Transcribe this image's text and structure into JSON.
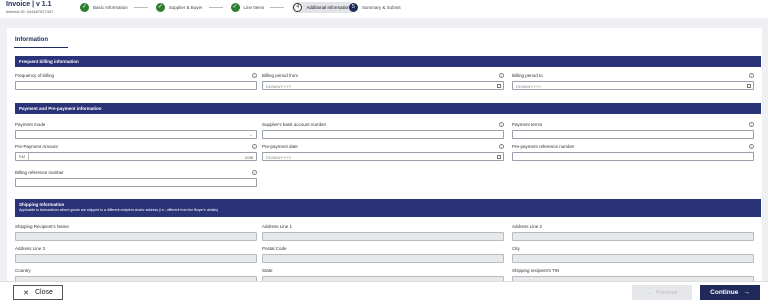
{
  "header": {
    "title": "Invoice | v 1.1",
    "internal_id": "Internal ID: 344467027447"
  },
  "steps": [
    {
      "label": "Basic Information",
      "status": "done"
    },
    {
      "label": "Supplier & Buyer",
      "status": "done"
    },
    {
      "label": "Line Items",
      "status": "done"
    },
    {
      "label": "Additional Information",
      "status": "active",
      "number": "4"
    },
    {
      "label": "Summary & Submit",
      "status": "pending",
      "number": "5"
    }
  ],
  "tab": "Information",
  "sections": {
    "billing": "Frequent billing information",
    "payment": "Payment and Pre-payment information",
    "shipping": "Shipping Information",
    "shipping_note": "Applicable to transactions where goods are shipped to a different recipient and/or address (i.e., different from the Buyer's details)"
  },
  "fields": {
    "frequency": {
      "label": "Frequency of billing",
      "value": ""
    },
    "period_from": {
      "label": "Billing period from",
      "placeholder": "DD/MM/YYYY"
    },
    "period_to": {
      "label": "Billing period to",
      "placeholder": "DD/MM/YYYY"
    },
    "payment_mode": {
      "label": "Payment mode",
      "value": ""
    },
    "bank_account": {
      "label": "Supplier's bank account number",
      "value": ""
    },
    "payment_terms": {
      "label": "Payment terms",
      "value": ""
    },
    "prepayment_amount": {
      "label": "Pre-Payment Amount",
      "currency": "RM",
      "value": "0.00"
    },
    "prepayment_date": {
      "label": "Pre-payment date",
      "placeholder": "DD/MM/YYYY"
    },
    "prepayment_ref": {
      "label": "Pre-payment reference number",
      "value": ""
    },
    "billing_ref": {
      "label": "Billing reference number",
      "value": ""
    },
    "recipient_name": {
      "label": "Shipping Recipient's Name"
    },
    "address1": {
      "label": "Address Line 1"
    },
    "address2": {
      "label": "Address Line 2"
    },
    "address3": {
      "label": "Address Line 3"
    },
    "postal": {
      "label": "Postal Code"
    },
    "city": {
      "label": "City"
    },
    "country": {
      "label": "Country"
    },
    "state": {
      "label": "State"
    },
    "recipient_tin": {
      "label": "Shipping recipient's TIN"
    }
  },
  "footer": {
    "close": "Close",
    "previous": "Previous",
    "continue": "Continue"
  },
  "colors": {
    "primary": "#2b3378",
    "success": "#2e7d32"
  }
}
